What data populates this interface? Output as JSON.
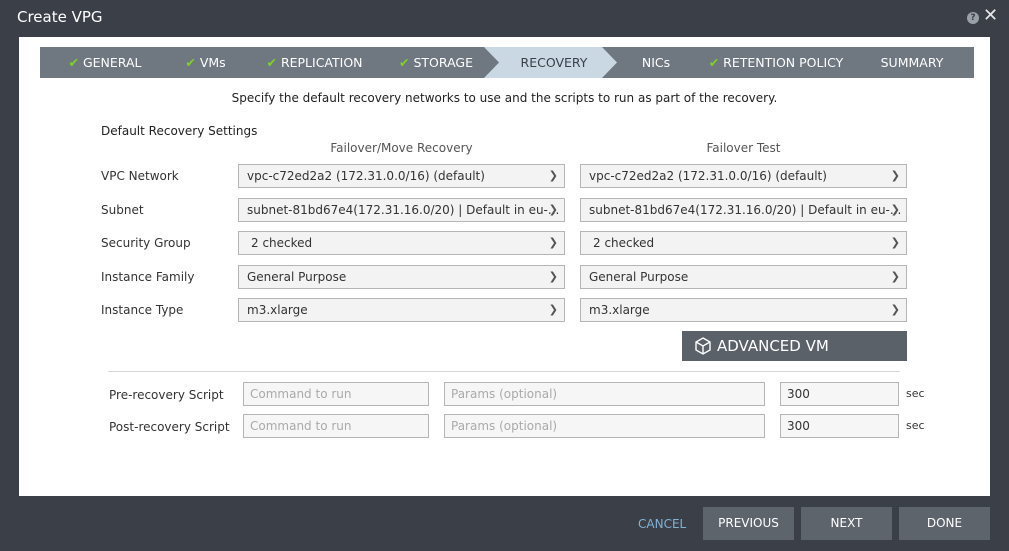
{
  "window": {
    "title": "Create VPG"
  },
  "wizard": {
    "steps": [
      {
        "label": "GENERAL",
        "check": "✔"
      },
      {
        "label": "VMs",
        "check": "✔"
      },
      {
        "label": "REPLICATION",
        "check": "✔"
      },
      {
        "label": "STORAGE",
        "check": "✔"
      },
      {
        "label": "RECOVERY",
        "check": ""
      },
      {
        "label": "NICs",
        "check": ""
      },
      {
        "label": "RETENTION POLICY",
        "check": "✔"
      },
      {
        "label": "SUMMARY",
        "check": ""
      }
    ],
    "active_step": "RECOVERY",
    "check_color": "#7ed321",
    "active_color": "#c9d8e3"
  },
  "intro": "Specify the default recovery networks to use and the scripts to run as part of the recovery.",
  "settings": {
    "title": "Default Recovery Settings",
    "col_failover": "Failover/Move Recovery",
    "col_test": "Failover Test",
    "rows": [
      {
        "label": "VPC Network",
        "failover": "vpc-c72ed2a2 (172.31.0.0/16) (default)",
        "test": "vpc-c72ed2a2 (172.31.0.0/16) (default)"
      },
      {
        "label": "Subnet",
        "failover": "subnet-81bd67e4(172.31.16.0/20) | Default in eu-...",
        "test": "subnet-81bd67e4(172.31.16.0/20) | Default in eu-..."
      },
      {
        "label": "Security Group",
        "failover": "2 checked",
        "test": "2 checked"
      },
      {
        "label": "Instance Family",
        "failover": "General Purpose",
        "test": "General Purpose"
      },
      {
        "label": "Instance Type",
        "failover": "m3.xlarge",
        "test": "m3.xlarge"
      }
    ],
    "advanced_button": "ADVANCED VM SETTINGS"
  },
  "scripts": {
    "pre": {
      "label": "Pre-recovery Script",
      "command_placeholder": "Command to run",
      "params_placeholder": "Params (optional)",
      "timeout": "300",
      "unit": "sec"
    },
    "post": {
      "label": "Post-recovery Script",
      "command_placeholder": "Command to run",
      "params_placeholder": "Params (optional)",
      "timeout": "300",
      "unit": "sec"
    }
  },
  "footer": {
    "cancel": "CANCEL",
    "previous": "PREVIOUS",
    "next": "NEXT",
    "done": "DONE"
  }
}
